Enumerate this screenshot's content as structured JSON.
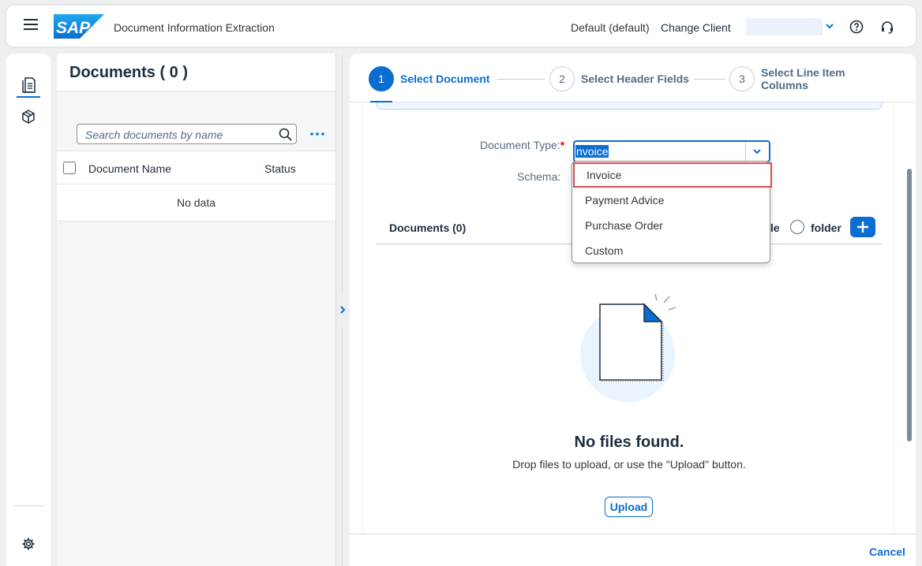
{
  "shell": {
    "app_title": "Document Information Extraction",
    "tenant": "Default (default)",
    "change_client": "Change Client",
    "logo_text": "SAP"
  },
  "sidenav": {
    "items": [
      {
        "icon": "documents-icon",
        "selected": true
      },
      {
        "icon": "box-icon",
        "selected": false
      }
    ],
    "bottom_icon": "settings-gear-icon"
  },
  "documents_list": {
    "title": "Documents ( 0 )",
    "search_placeholder": "Search documents by name",
    "columns": [
      "Document Name",
      "Status"
    ],
    "empty_text": "No data"
  },
  "wizard": {
    "steps": [
      {
        "number": "1",
        "label": "Select Document",
        "active": true
      },
      {
        "number": "2",
        "label": "Select Header Fields",
        "active": false
      },
      {
        "number": "3",
        "label_line1": "Select Line Item",
        "label_line2": "Columns",
        "active": false
      }
    ]
  },
  "form": {
    "document_type_label": "Document Type:",
    "required_marker": "*",
    "document_type_value": "nvoice",
    "schema_label": "Schema:"
  },
  "dropdown": {
    "options": [
      "Invoice",
      "Payment Advice",
      "Purchase Order",
      "Custom"
    ],
    "highlighted": "Invoice"
  },
  "upload_area": {
    "docs_title": "Documents (0)",
    "file_label": "ile",
    "folder_label": "folder",
    "empty_title": "No files found.",
    "empty_subtitle": "Drop files to upload, or use the \"Upload\" button.",
    "upload_button": "Upload"
  },
  "footer": {
    "cancel": "Cancel"
  },
  "colors": {
    "accent": "#0a6ed1",
    "highlight_border": "#e04b4b",
    "required": "#ee0000"
  }
}
